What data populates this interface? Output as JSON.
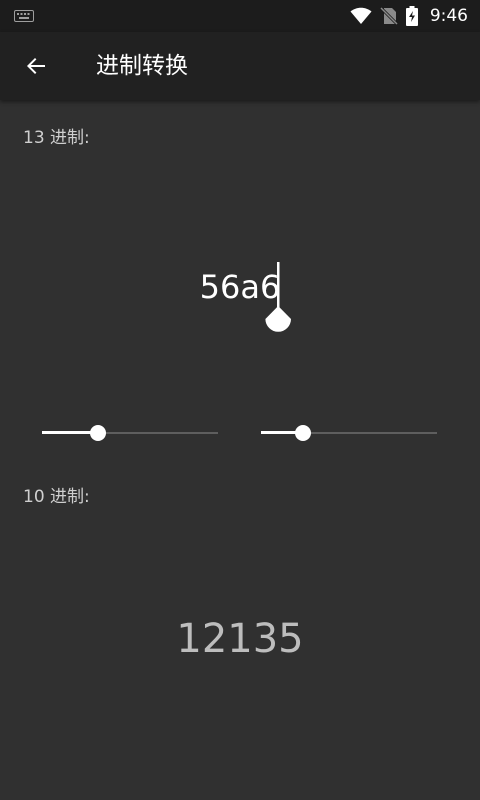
{
  "status_bar": {
    "time": "9:46",
    "icons": [
      "keyboard-icon",
      "wifi-icon",
      "no-sim-icon",
      "battery-charging-icon"
    ]
  },
  "app_bar": {
    "title": "进制转换",
    "back_icon": "arrow-left-icon"
  },
  "input_section": {
    "label": "13 进制:",
    "value": "56a6"
  },
  "sliders": [
    {
      "name": "source-base-slider",
      "fraction": 0.32
    },
    {
      "name": "target-base-slider",
      "fraction": 0.24
    }
  ],
  "output_section": {
    "label": "10 进制:",
    "value": "12135"
  },
  "colors": {
    "background": "#303030",
    "app_bar": "#212121",
    "status_bar": "#1c1c1c",
    "accent": "#ffffff",
    "result_text": "#bdbdbd"
  }
}
